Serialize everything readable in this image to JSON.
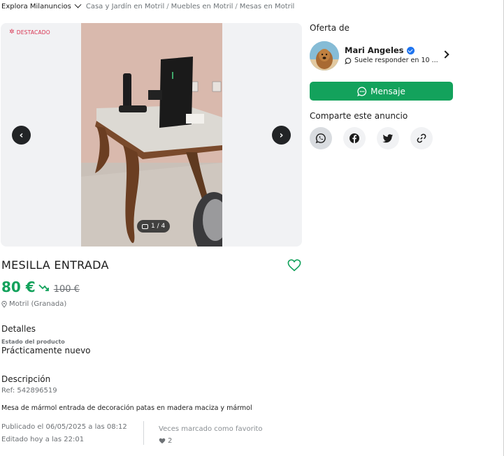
{
  "breadcrumb": {
    "explore": "Explora Milanuncios",
    "items": [
      "Casa y Jardín en Motril",
      "Muebles en Motril",
      "Mesas en Motril"
    ]
  },
  "gallery": {
    "badge": "DESTACADO",
    "counter": "1 / 4",
    "prev_icon": "chevron-left-icon",
    "next_icon": "chevron-right-icon"
  },
  "listing": {
    "title": "MESILLA ENTRADA",
    "price": "80 €",
    "old_price": "100 €",
    "location": "Motril (Granada)",
    "details_heading": "Detalles",
    "state_label": "Estado del producto",
    "state_value": "Prácticamente nuevo",
    "description_heading": "Descripción",
    "ref": "Ref: 542896519",
    "description": "Mesa de mármol entrada de decoración patas en madera maciza y mármol",
    "published": "Publicado el 06/05/2025 a las 08:12",
    "edited": "Editado hoy a las 22:01",
    "favorites_label": "Veces marcado como favorito",
    "favorites_count": "2"
  },
  "seller": {
    "offer_label": "Oferta de",
    "name": "Mari Angeles",
    "response": "Suele responder en 10 ...",
    "message_button": "Mensaje"
  },
  "share": {
    "label": "Comparte este anuncio",
    "icons": [
      "whatsapp-icon",
      "facebook-icon",
      "twitter-icon",
      "link-icon"
    ]
  },
  "colors": {
    "accent_green": "#13a25c",
    "badge_red": "#d8314e",
    "muted_text": "#6d7175",
    "verified_blue": "#1e74f0"
  }
}
